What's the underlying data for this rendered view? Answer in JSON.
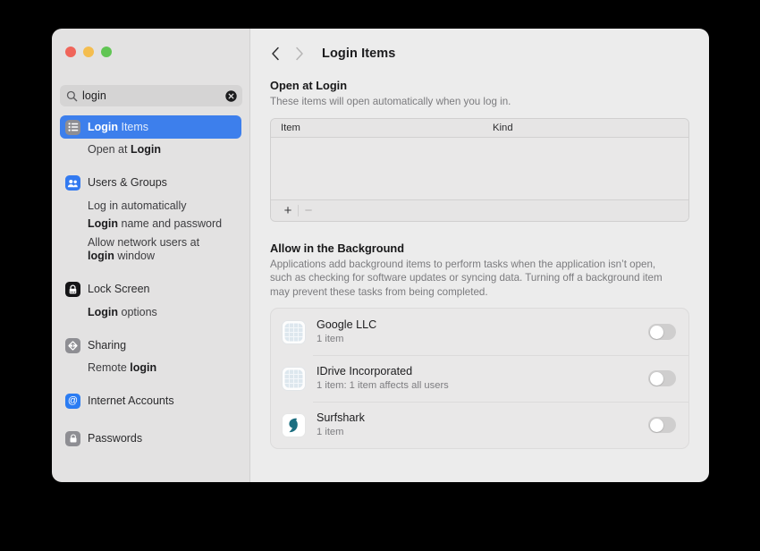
{
  "window": {
    "traffic_lights": [
      "close",
      "minimize",
      "maximize"
    ],
    "colors": {
      "close": "#f0655a",
      "minimize": "#f4bd4f",
      "maximize": "#61c554",
      "accent": "#3d7fec",
      "sidebar_bg": "#e3e2e2",
      "content_bg": "#ececec",
      "surfshark_teal": "#1c6e80"
    }
  },
  "search": {
    "value": "login",
    "placeholder": "Search",
    "icon": "search-icon",
    "clear_icon": "clear-circle-icon"
  },
  "sidebar": {
    "items": [
      {
        "type": "result",
        "label": "Login Items",
        "bold_prefix": "Login",
        "rest": " Items",
        "icon": "login-items-icon",
        "selected": true
      },
      {
        "type": "sub",
        "label": "Open at Login",
        "segments": [
          {
            "text": "Open at ",
            "bold": false
          },
          {
            "text": "Login",
            "bold": true
          }
        ]
      },
      {
        "type": "result",
        "label": "Users & Groups",
        "bold_prefix": "",
        "rest": "Users & Groups",
        "icon": "users-groups-icon",
        "selected": false
      },
      {
        "type": "sub",
        "label": "Log in automatically",
        "segments": [
          {
            "text": "Log in automatically",
            "bold": false
          }
        ]
      },
      {
        "type": "sub",
        "label": "Login name and password",
        "segments": [
          {
            "text": "Login",
            "bold": true
          },
          {
            "text": " name and password",
            "bold": false
          }
        ]
      },
      {
        "type": "sub",
        "label": "Allow network users at login window",
        "segments": [
          {
            "text": "Allow network users at ",
            "bold": false
          },
          {
            "text": "login",
            "bold": true
          },
          {
            "text": " window",
            "bold": false
          }
        ]
      },
      {
        "type": "result",
        "label": "Lock Screen",
        "bold_prefix": "",
        "rest": "Lock Screen",
        "icon": "lock-screen-icon",
        "selected": false
      },
      {
        "type": "sub",
        "label": "Login options",
        "segments": [
          {
            "text": "Login",
            "bold": true
          },
          {
            "text": " options",
            "bold": false
          }
        ]
      },
      {
        "type": "result",
        "label": "Sharing",
        "bold_prefix": "",
        "rest": "Sharing",
        "icon": "sharing-icon",
        "selected": false
      },
      {
        "type": "sub",
        "label": "Remote login",
        "segments": [
          {
            "text": "Remote ",
            "bold": false
          },
          {
            "text": "login",
            "bold": true
          }
        ]
      },
      {
        "type": "result",
        "label": "Internet Accounts",
        "bold_prefix": "",
        "rest": "Internet Accounts",
        "icon": "internet-accounts-icon",
        "selected": false
      },
      {
        "type": "result",
        "label": "Passwords",
        "bold_prefix": "",
        "rest": "Passwords",
        "icon": "passwords-icon",
        "selected": false
      }
    ]
  },
  "toolbar": {
    "back_icon": "chevron-left-icon",
    "forward_icon": "chevron-right-icon",
    "title": "Login Items"
  },
  "open_at_login": {
    "heading": "Open at Login",
    "description": "These items will open automatically when you log in.",
    "columns": [
      "Item",
      "Kind"
    ],
    "rows": [],
    "add_label": "+",
    "remove_label": "−"
  },
  "allow_background": {
    "heading": "Allow in the Background",
    "description": "Applications add background items to perform tasks when the application isn’t open, such as checking for software updates or syncing data. Turning off a background item may prevent these tasks from being completed.",
    "apps": [
      {
        "name": "Google LLC",
        "detail": "1 item",
        "icon": "generic-app-icon",
        "enabled": false
      },
      {
        "name": "IDrive Incorporated",
        "detail": "1 item: 1 item affects all users",
        "icon": "generic-app-icon",
        "enabled": false
      },
      {
        "name": "Surfshark",
        "detail": "1 item",
        "icon": "surfshark-icon",
        "enabled": false
      }
    ]
  }
}
